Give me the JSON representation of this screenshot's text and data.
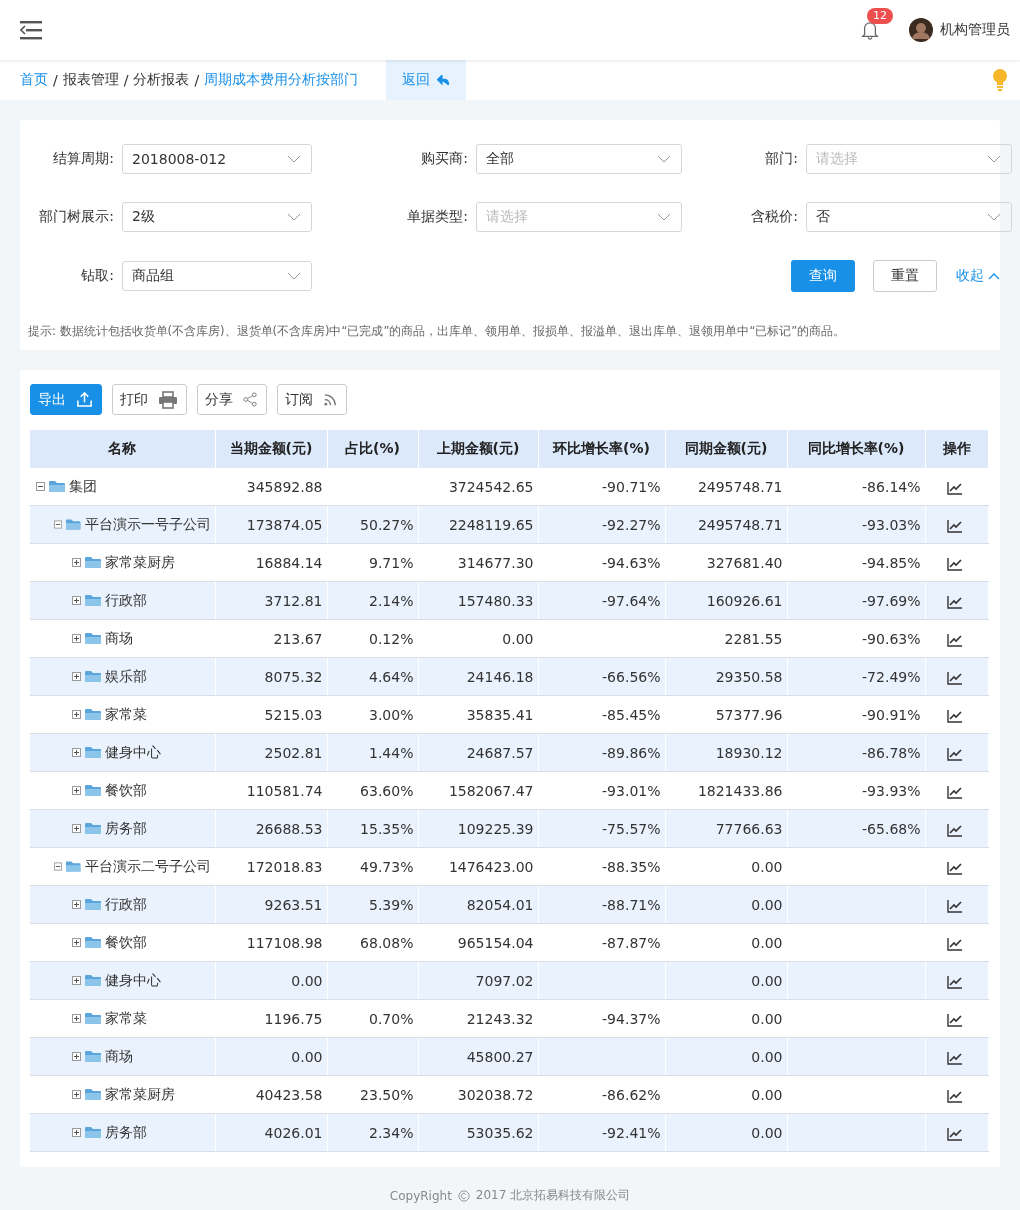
{
  "header": {
    "notification_count": "12",
    "user": "机构管理员"
  },
  "breadcrumb": [
    {
      "label": "首页",
      "link": true
    },
    {
      "label": "报表管理",
      "link": false
    },
    {
      "label": "分析报表",
      "link": false
    },
    {
      "label": "周期成本费用分析按部门",
      "link": true
    }
  ],
  "breadcrumb_separator": "/",
  "back_button": "返回",
  "filters": [
    {
      "label": "结算周期:",
      "value": "2018008-012"
    },
    {
      "label": "购买商:",
      "value": "全部"
    },
    {
      "label": "部门:",
      "placeholder": "请选择"
    },
    {
      "label": "部门树展示:",
      "value": "2级"
    },
    {
      "label": "单据类型:",
      "placeholder": "请选择"
    },
    {
      "label": "含税价:",
      "value": "否"
    },
    {
      "label": "钻取:",
      "value": "商品组"
    }
  ],
  "actions": {
    "query": "查询",
    "reset": "重置",
    "collapse": "收起"
  },
  "hint": "提示: 数据统计包括收货单(不含库房)、退货单(不含库房)中“已完成”的商品，出库单、领用单、报损单、报溢单、退出库单、退领用单中“已标记”的商品。",
  "toolbar": [
    {
      "label": "导出",
      "kind": "export"
    },
    {
      "label": "打印",
      "kind": "print"
    },
    {
      "label": "分享",
      "kind": "share"
    },
    {
      "label": "订阅",
      "kind": "subscribe"
    }
  ],
  "table": {
    "columns": [
      "名称",
      "当期金额(元)",
      "占比(%)",
      "上期金额(元)",
      "环比增长率(%)",
      "同期金额(元)",
      "同比增长率(%)",
      "操作"
    ],
    "rows": [
      {
        "name": "集团",
        "expanded": true,
        "current": "345892.88",
        "previous": "3724542.65",
        "mom": "-90.71%",
        "last_year": "2495748.71",
        "yoy": "-86.14%",
        "children": [
          {
            "name": "平台演示一号子公司",
            "expanded": true,
            "current": "173874.05",
            "share": "50.27%",
            "previous": "2248119.65",
            "mom": "-92.27%",
            "last_year": "2495748.71",
            "yoy": "-93.03%",
            "children": [
              {
                "name": "家常菜厨房",
                "expanded": false,
                "current": "16884.14",
                "share": "9.71%",
                "previous": "314677.30",
                "mom": "-94.63%",
                "last_year": "327681.40",
                "yoy": "-94.85%"
              },
              {
                "name": "行政部",
                "expanded": false,
                "current": "3712.81",
                "share": "2.14%",
                "previous": "157480.33",
                "mom": "-97.64%",
                "last_year": "160926.61",
                "yoy": "-97.69%"
              },
              {
                "name": "商场",
                "expanded": false,
                "current": "213.67",
                "share": "0.12%",
                "previous": "0.00",
                "last_year": "2281.55",
                "yoy": "-90.63%"
              },
              {
                "name": "娱乐部",
                "expanded": false,
                "current": "8075.32",
                "share": "4.64%",
                "previous": "24146.18",
                "mom": "-66.56%",
                "last_year": "29350.58",
                "yoy": "-72.49%"
              },
              {
                "name": "家常菜",
                "expanded": false,
                "current": "5215.03",
                "share": "3.00%",
                "previous": "35835.41",
                "mom": "-85.45%",
                "last_year": "57377.96",
                "yoy": "-90.91%"
              },
              {
                "name": "健身中心",
                "expanded": false,
                "current": "2502.81",
                "share": "1.44%",
                "previous": "24687.57",
                "mom": "-89.86%",
                "last_year": "18930.12",
                "yoy": "-86.78%"
              },
              {
                "name": "餐饮部",
                "expanded": false,
                "current": "110581.74",
                "share": "63.60%",
                "previous": "1582067.47",
                "mom": "-93.01%",
                "last_year": "1821433.86",
                "yoy": "-93.93%"
              },
              {
                "name": "房务部",
                "expanded": false,
                "current": "26688.53",
                "share": "15.35%",
                "previous": "109225.39",
                "mom": "-75.57%",
                "last_year": "77766.63",
                "yoy": "-65.68%"
              }
            ]
          },
          {
            "name": "平台演示二号子公司",
            "expanded": true,
            "current": "172018.83",
            "share": "49.73%",
            "previous": "1476423.00",
            "mom": "-88.35%",
            "last_year": "0.00",
            "children": [
              {
                "name": "行政部",
                "expanded": false,
                "current": "9263.51",
                "share": "5.39%",
                "previous": "82054.01",
                "mom": "-88.71%",
                "last_year": "0.00"
              },
              {
                "name": "餐饮部",
                "expanded": false,
                "current": "117108.98",
                "share": "68.08%",
                "previous": "965154.04",
                "mom": "-87.87%",
                "last_year": "0.00"
              },
              {
                "name": "健身中心",
                "expanded": false,
                "current": "0.00",
                "previous": "7097.02",
                "last_year": "0.00"
              },
              {
                "name": "家常菜",
                "expanded": false,
                "current": "1196.75",
                "share": "0.70%",
                "previous": "21243.32",
                "mom": "-94.37%",
                "last_year": "0.00"
              },
              {
                "name": "商场",
                "expanded": false,
                "current": "0.00",
                "previous": "45800.27",
                "last_year": "0.00"
              },
              {
                "name": "家常菜厨房",
                "expanded": false,
                "current": "40423.58",
                "share": "23.50%",
                "previous": "302038.72",
                "mom": "-86.62%",
                "last_year": "0.00"
              },
              {
                "name": "房务部",
                "expanded": false,
                "current": "4026.01",
                "share": "2.34%",
                "previous": "53035.62",
                "mom": "-92.41%",
                "last_year": "0.00"
              }
            ]
          }
        ]
      }
    ]
  },
  "footer": {
    "copyright": "CopyRight",
    "year_company": "2017 北京拓易科技有限公司"
  }
}
